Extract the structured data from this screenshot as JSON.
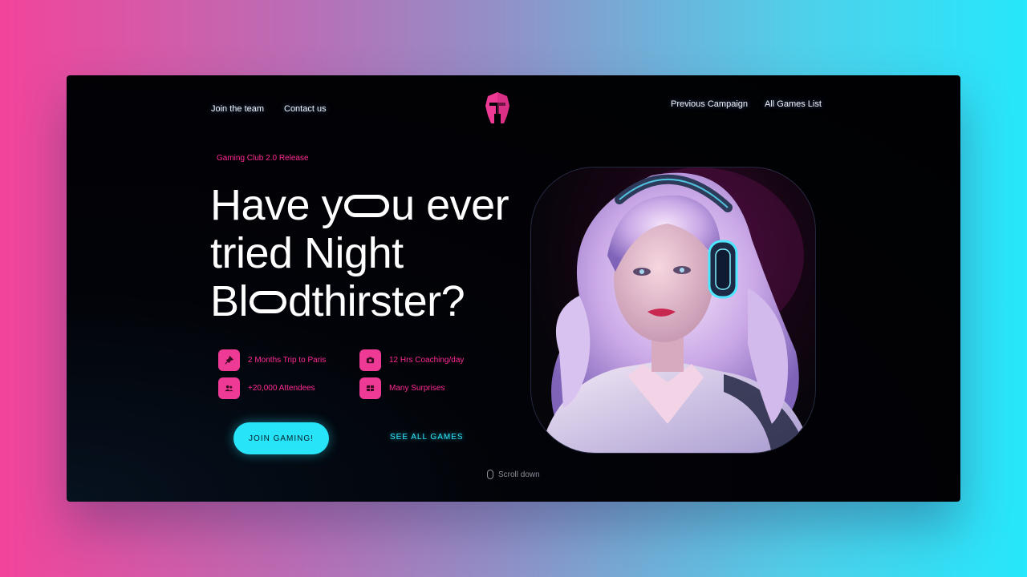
{
  "nav": {
    "left": [
      {
        "label": "Join the team"
      },
      {
        "label": "Contact us"
      }
    ],
    "right": [
      {
        "label": "Previous Campaign"
      },
      {
        "label": "All Games List"
      }
    ]
  },
  "hero": {
    "tag": "Gaming Club 2.0 Release",
    "headline": {
      "line1_a": "Have y",
      "line1_b": "u ever",
      "line2": "tried Night",
      "line3_a": "Bl",
      "line3_b": "dthirster?"
    },
    "features": [
      {
        "label": "2 Months Trip to Paris",
        "icon": "pin-icon"
      },
      {
        "label": "12 Hrs Coaching/day",
        "icon": "camera-icon"
      },
      {
        "label": "+20,000 Attendees",
        "icon": "users-icon"
      },
      {
        "label": "Many Surprises",
        "icon": "gift-icon"
      }
    ],
    "cta_primary": "JOIN GAMING!",
    "cta_secondary": "SEE ALL GAMES",
    "scroll_label": "Scroll down"
  },
  "colors": {
    "accent_pink": "#ef3a95",
    "accent_cyan": "#27e4f8",
    "background": "#020308"
  }
}
